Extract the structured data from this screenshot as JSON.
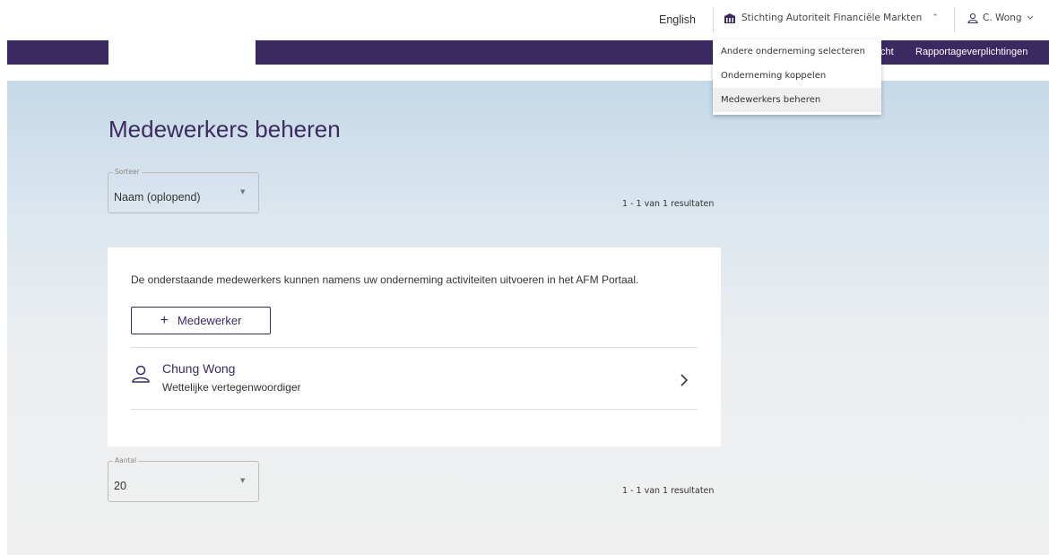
{
  "header": {
    "language": "English",
    "organization": "Stichting Autoriteit Financiële Markten",
    "user": "C. Wong"
  },
  "nav": {
    "items": [
      "cht",
      "Rapportageverplichtingen"
    ]
  },
  "dropdown": {
    "items": [
      "Andere onderneming selecteren",
      "Onderneming koppelen",
      "Medewerkers beheren"
    ]
  },
  "main": {
    "title": "Medewerkers beheren",
    "sort": {
      "legend": "Sorteer",
      "value": "Naam (oplopend)"
    },
    "results_text": "1 - 1 van 1 resultaten",
    "intro": "De onderstaande medewerkers kunnen namens uw onderneming activiteiten uitvoeren in het AFM Portaal.",
    "add_button": {
      "icon": "+",
      "label": "Medewerker"
    },
    "employees": [
      {
        "name": "Chung Wong",
        "role": "Wettelijke vertegenwoordiger"
      }
    ],
    "count": {
      "legend": "Aantal",
      "value": "20"
    }
  },
  "colors": {
    "brand_purple": "#3b2a62",
    "title_purple": "#3a2c5e"
  }
}
